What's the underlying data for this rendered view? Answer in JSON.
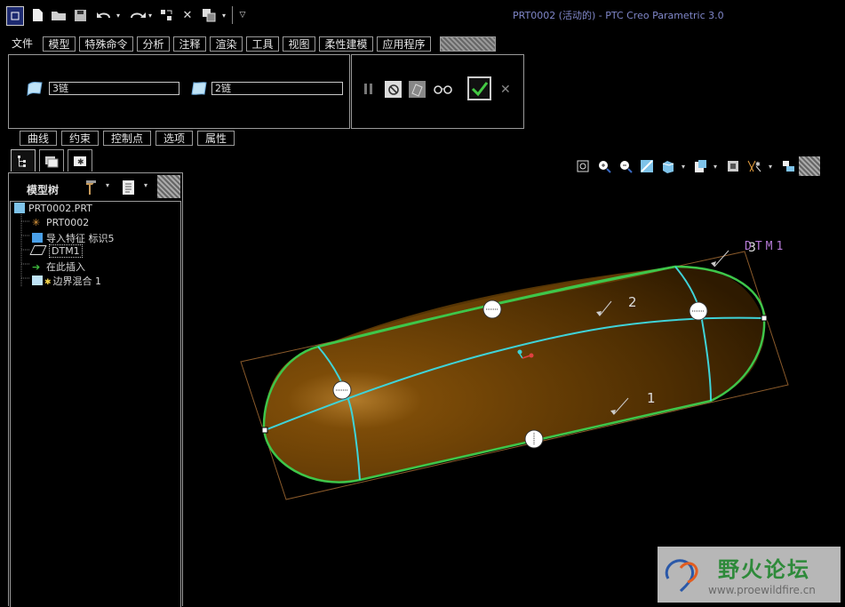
{
  "window": {
    "title": "PRT0002 (活动的) - PTC Creo Parametric 3.0"
  },
  "menu": {
    "items": [
      "文件",
      "模型",
      "特殊命令",
      "分析",
      "注释",
      "渲染",
      "工具",
      "视图",
      "柔性建模",
      "应用程序"
    ]
  },
  "feature_panel": {
    "first_direction_value": "3链",
    "second_direction_value": "2链"
  },
  "subtabs": [
    "曲线",
    "约束",
    "控制点",
    "选项",
    "属性"
  ],
  "model_tree": {
    "header": "模型树",
    "items": [
      {
        "label": "PRT0002.PRT",
        "icon": "part-icon"
      },
      {
        "label": "PRT0002",
        "icon": "csys-icon"
      },
      {
        "label": "导入特征 标识5",
        "icon": "import-feature-icon"
      },
      {
        "label": "DTM1",
        "icon": "datum-plane-icon"
      },
      {
        "label": "在此插入",
        "icon": "insert-arrow-icon"
      },
      {
        "label": "边界混合 1",
        "icon": "boundary-blend-icon"
      }
    ]
  },
  "viewport": {
    "datum_label": "DTM1",
    "curve_labels": [
      "3",
      "2",
      "1"
    ],
    "colors": {
      "surface": "#7a4a06",
      "curve_green": "#3ec64a",
      "curve_cyan": "#3fd3d8",
      "datum_outline": "#8a5a2a",
      "datum_text": "#b77ad8"
    }
  },
  "watermark": {
    "title": "野火论坛",
    "url": "www.proewildfire.cn"
  }
}
